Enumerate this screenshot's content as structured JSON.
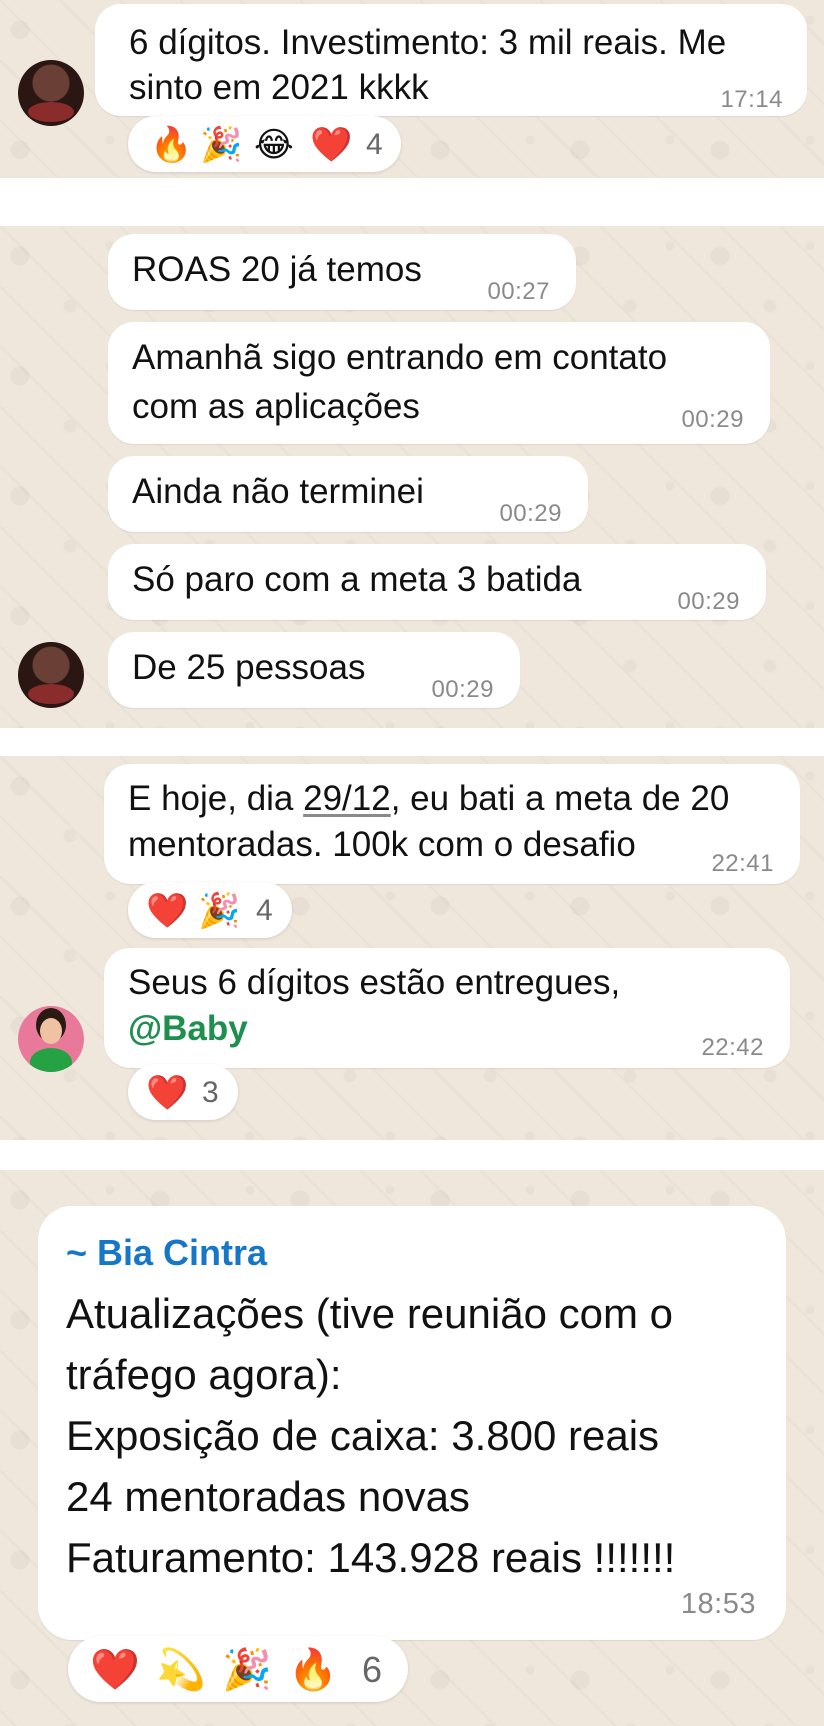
{
  "panel1": {
    "message": {
      "line1": "6 dígitos. Investimento: 3 mil reais. Me",
      "line2": "sinto em 2021 kkkk",
      "time": "17:14"
    },
    "reactions": {
      "emojis": [
        "🔥",
        "🎉",
        "😂",
        "❤️"
      ],
      "count": "4"
    }
  },
  "panel2": {
    "messages": [
      {
        "text": "ROAS 20 já temos",
        "time": "00:27"
      },
      {
        "line1": "Amanhã sigo entrando em contato",
        "line2": "com as aplicações",
        "time": "00:29"
      },
      {
        "text": "Ainda não terminei",
        "time": "00:29"
      },
      {
        "text": "Só paro com a meta 3 batida",
        "time": "00:29"
      },
      {
        "text": "De 25 pessoas",
        "time": "00:29"
      }
    ]
  },
  "panel3": {
    "message1": {
      "pre": "E hoje, dia ",
      "date": "29/12",
      "post": ", eu bati a meta de 20",
      "line2": "mentoradas. 100k com o desafio",
      "time": "22:41"
    },
    "reactions1": {
      "emojis": [
        "❤️",
        "🎉"
      ],
      "count": "4"
    },
    "message2": {
      "line1": "Seus 6 dígitos estão entregues,",
      "mention": "@Baby",
      "time": "22:42"
    },
    "reactions2": {
      "emojis": [
        "❤️"
      ],
      "count": "3"
    }
  },
  "panel4": {
    "sender": "~ Bia Cintra",
    "lines": [
      "Atualizações (tive reunião com o",
      "tráfego agora):",
      "Exposição de caixa: 3.800 reais",
      "24 mentoradas novas",
      "Faturamento: 143.928 reais !!!!!!!"
    ],
    "time": "18:53",
    "reactions": {
      "emojis": [
        "❤️",
        "💫",
        "🎉",
        "🔥"
      ],
      "count": "6"
    }
  }
}
